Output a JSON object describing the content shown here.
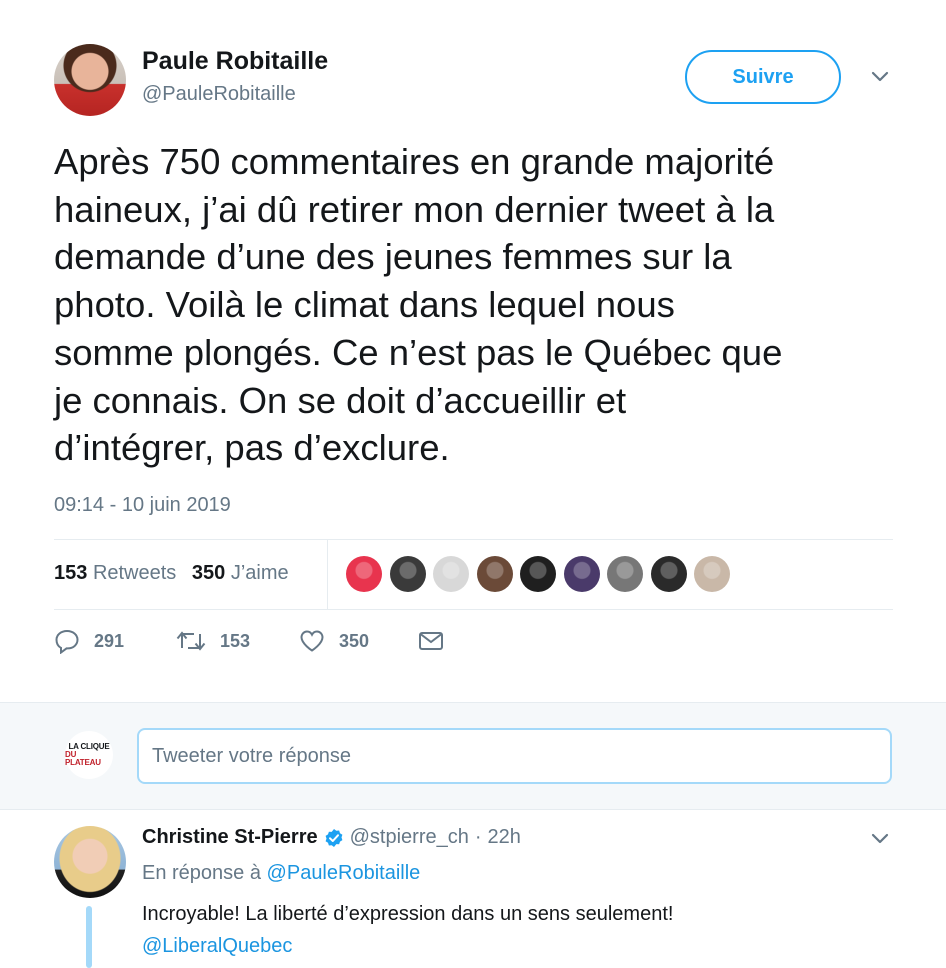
{
  "tweet": {
    "author_name": "Paule Robitaille",
    "author_handle": "@PauleRobitaille",
    "follow_label": "Suivre",
    "text_lines": [
      "Après 750 commentaires en grande majorité",
      "haineux, j’ai dû retirer mon dernier tweet à la",
      "demande d’une des jeunes femmes sur la",
      "photo. Voilà le climat dans lequel nous",
      "somme plongés. Ce n’est pas le Québec que",
      "je connais. On se doit d’accueillir et",
      "d’intégrer, pas d’exclure."
    ],
    "timestamp": "09:14 - 10 juin 2019",
    "stats": {
      "retweets_count": "153",
      "retweets_label": "Retweets",
      "likes_count": "350",
      "likes_label": "J’aime"
    },
    "liker_colors": [
      "#e8344e",
      "#3a3a3a",
      "#d8d8d8",
      "#6b4a38",
      "#1f1f1f",
      "#4a3a6a",
      "#777777",
      "#2a2a2a",
      "#c9b8a8"
    ],
    "actions": {
      "reply_count": "291",
      "retweet_count": "153",
      "like_count": "350"
    }
  },
  "composer": {
    "avatar_line1": "LA CLIQUE",
    "avatar_line2": "DU PLATEAU",
    "placeholder": "Tweeter votre réponse"
  },
  "reply": {
    "author_name": "Christine St-Pierre",
    "author_handle": "@stpierre_ch",
    "separator": "·",
    "time": "22h",
    "in_reply_prefix": "En réponse à",
    "in_reply_handle": "@PauleRobitaille",
    "text": "Incroyable! La liberté d’expression dans un sens seulement!",
    "mention": "@LiberalQuebec"
  },
  "colors": {
    "accent": "#1da1f2",
    "muted": "#657786",
    "verified": "#1da1f2"
  }
}
